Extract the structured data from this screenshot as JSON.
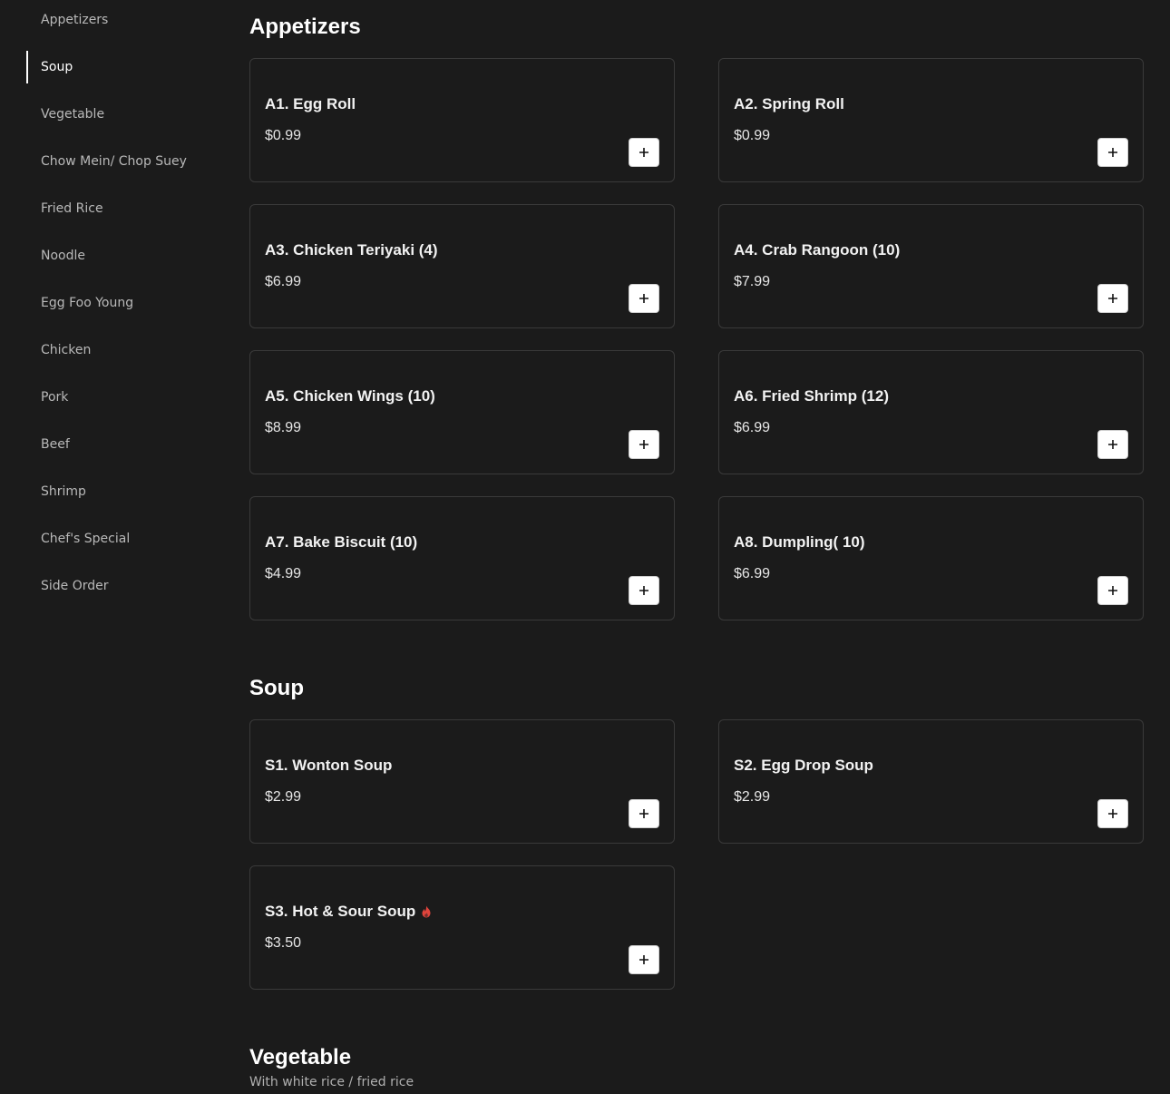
{
  "sidebar": {
    "items": [
      {
        "label": "Appetizers"
      },
      {
        "label": "Soup"
      },
      {
        "label": "Vegetable"
      },
      {
        "label": "Chow Mein/ Chop Suey"
      },
      {
        "label": "Fried Rice"
      },
      {
        "label": "Noodle"
      },
      {
        "label": "Egg Foo Young"
      },
      {
        "label": "Chicken"
      },
      {
        "label": "Pork"
      },
      {
        "label": "Beef"
      },
      {
        "label": "Shrimp"
      },
      {
        "label": "Chef's Special"
      },
      {
        "label": "Side Order"
      }
    ],
    "active": "Soup"
  },
  "sections": {
    "appetizers": {
      "title": "Appetizers",
      "items": [
        {
          "name": "A1. Egg Roll",
          "price": "$0.99"
        },
        {
          "name": "A2. Spring Roll",
          "price": "$0.99"
        },
        {
          "name": "A3. Chicken Teriyaki (4)",
          "price": "$6.99"
        },
        {
          "name": "A4. Crab Rangoon (10)",
          "price": "$7.99"
        },
        {
          "name": "A5. Chicken Wings (10)",
          "price": "$8.99"
        },
        {
          "name": "A6. Fried Shrimp (12)",
          "price": "$6.99"
        },
        {
          "name": "A7. Bake Biscuit (10)",
          "price": "$4.99"
        },
        {
          "name": "A8. Dumpling( 10)",
          "price": "$6.99"
        }
      ]
    },
    "soup": {
      "title": "Soup",
      "items": [
        {
          "name": "S1. Wonton Soup",
          "price": "$2.99"
        },
        {
          "name": "S2. Egg Drop Soup",
          "price": "$2.99"
        },
        {
          "name": "S3. Hot & Sour Soup",
          "price": "$3.50",
          "icon": "spicy-flame-icon"
        }
      ]
    },
    "vegetable": {
      "title": "Vegetable",
      "subtitle": "With white rice / fried rice"
    }
  },
  "icons": {
    "add": "plus-icon",
    "spicy": "spicy-flame-icon"
  },
  "colors": {
    "background": "#1b1b1b",
    "card_border": "#3a3a3a",
    "add_button": "#ffffff",
    "spicy": "#e0443c"
  }
}
